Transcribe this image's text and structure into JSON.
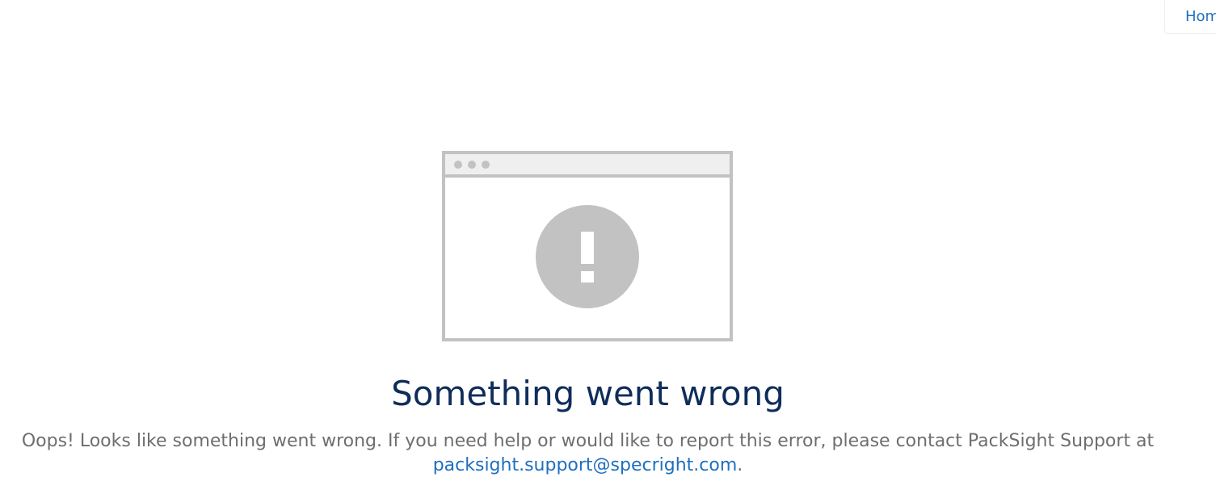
{
  "nav": {
    "home_label": "Home"
  },
  "error": {
    "title": "Something went wrong",
    "message": "Oops! Looks like something went wrong. If you need help or would like to report this error, please contact PackSight Support at",
    "support_email": "packsight.support@specright.com",
    "trailing_punct": "."
  },
  "colors": {
    "title": "#0f2d5a",
    "link": "#1f6fbf",
    "body_text": "#6e6e6e",
    "illustration": "#c2c2c2"
  },
  "icons": {
    "illustration": "browser-window-error-icon"
  }
}
